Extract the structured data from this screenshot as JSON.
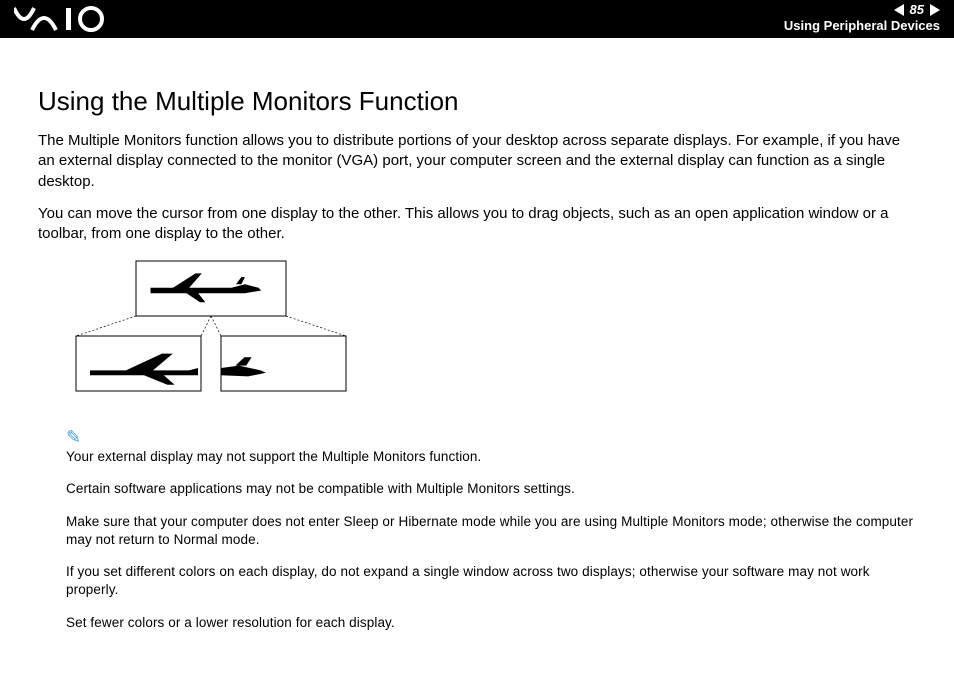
{
  "header": {
    "page_number": "85",
    "section": "Using Peripheral Devices"
  },
  "title": "Using the Multiple Monitors Function",
  "paragraphs": {
    "p1": "The Multiple Monitors function allows you to distribute portions of your desktop across separate displays. For example, if you have an external display connected to the monitor (VGA) port, your computer screen and the external display can function as a single desktop.",
    "p2": "You can move the cursor from one display to the other. This allows you to drag objects, such as an open application window or a toolbar, from one display to the other."
  },
  "notes": {
    "n1": "Your external display may not support the Multiple Monitors function.",
    "n2": "Certain software applications may not be compatible with Multiple Monitors settings.",
    "n3": "Make sure that your computer does not enter Sleep or Hibernate mode while you are using Multiple Monitors mode; otherwise the computer may not return to Normal mode.",
    "n4": "If you set different colors on each display, do not expand a single window across two displays; otherwise your software may not work properly.",
    "n5": "Set fewer colors or a lower resolution for each display."
  }
}
